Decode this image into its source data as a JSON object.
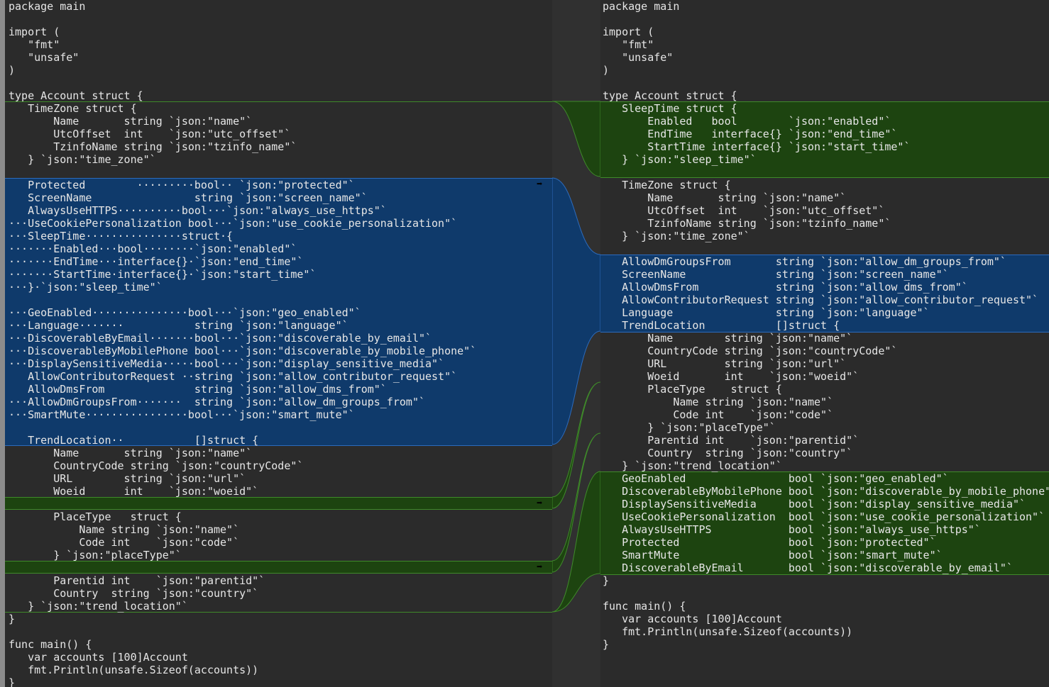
{
  "colors": {
    "background": "#2b2b2b",
    "text": "#e6e6e6",
    "changed_block": "#0f3a6b",
    "changed_border": "#2c6bbd",
    "inserted_block": "#1d4410",
    "inserted_border": "#3f8a2a",
    "gutter": "#8c8c8c"
  },
  "icons": {
    "copy_right": "arrow-right-icon",
    "copy_left": "arrow-left-icon"
  },
  "left": {
    "lines": [
      "package main",
      "",
      "import (",
      "   \"fmt\"",
      "   \"unsafe\"",
      ")",
      "",
      "type Account struct {",
      "   TimeZone struct {",
      "       Name       string `json:\"name\"`",
      "       UtcOffset  int    `json:\"utc_offset\"`",
      "       TzinfoName string `json:\"tzinfo_name\"`",
      "   } `json:\"time_zone\"`",
      "",
      "   Protected        ·········bool·· `json:\"protected\"`",
      "   ScreenName                string `json:\"screen_name\"`",
      "   AlwaysUseHTTPS··········bool···`json:\"always_use_https\"`",
      "···UseCookiePersonalization bool···`json:\"use_cookie_personalization\"`",
      "···SleepTime···············struct·{",
      "·······Enabled···bool········`json:\"enabled\"`",
      "·······EndTime···interface{}·`json:\"end_time\"`",
      "·······StartTime·interface{}·`json:\"start_time\"`",
      "···}·`json:\"sleep_time\"`",
      "",
      "···GeoEnabled···············bool···`json:\"geo_enabled\"`",
      "···Language·······           string `json:\"language\"`",
      "···DiscoverableByEmail·······bool···`json:\"discoverable_by_email\"`",
      "···DiscoverableByMobilePhone bool···`json:\"discoverable_by_mobile_phone\"`",
      "···DisplaySensitiveMedia·····bool···`json:\"display_sensitive_media\"`",
      "   AllowContributorRequest ··string `json:\"allow_contributor_request\"`",
      "   AllowDmsFrom              string `json:\"allow_dms_from\"`",
      "···AllowDmGroupsFrom·······  string `json:\"allow_dm_groups_from\"`",
      "···SmartMute················bool···`json:\"smart_mute\"`",
      "",
      "   TrendLocation··           []struct {",
      "       Name       string `json:\"name\"`",
      "       CountryCode string `json:\"countryCode\"`",
      "       URL        string `json:\"url\"`",
      "       Woeid      int    `json:\"woeid\"`",
      "",
      "       PlaceType   struct {",
      "           Name string `json:\"name\"`",
      "           Code int    `json:\"code\"`",
      "       } `json:\"placeType\"`",
      "",
      "       Parentid int    `json:\"parentid\"`",
      "       Country  string `json:\"country\"`",
      "   } `json:\"trend_location\"`",
      "}",
      "",
      "func main() {",
      "   var accounts [100]Account",
      "   fmt.Println(unsafe.Sizeof(accounts))",
      "}"
    ]
  },
  "right": {
    "lines": [
      "package main",
      "",
      "import (",
      "   \"fmt\"",
      "   \"unsafe\"",
      ")",
      "",
      "type Account struct {",
      "   SleepTime struct {",
      "       Enabled   bool        `json:\"enabled\"`",
      "       EndTime   interface{} `json:\"end_time\"`",
      "       StartTime interface{} `json:\"start_time\"`",
      "   } `json:\"sleep_time\"`",
      "",
      "   TimeZone struct {",
      "       Name       string `json:\"name\"`",
      "       UtcOffset  int    `json:\"utc_offset\"`",
      "       TzinfoName string `json:\"tzinfo_name\"`",
      "   } `json:\"time_zone\"`",
      "",
      "   AllowDmGroupsFrom       string `json:\"allow_dm_groups_from\"`",
      "   ScreenName              string `json:\"screen_name\"`",
      "   AllowDmsFrom            string `json:\"allow_dms_from\"`",
      "   AllowContributorRequest string `json:\"allow_contributor_request\"`",
      "   Language                string `json:\"language\"`",
      "   TrendLocation           []struct {",
      "       Name        string `json:\"name\"`",
      "       CountryCode string `json:\"countryCode\"`",
      "       URL         string `json:\"url\"`",
      "       Woeid       int    `json:\"woeid\"`",
      "       PlaceType    struct {",
      "           Name string `json:\"name\"`",
      "           Code int    `json:\"code\"`",
      "       } `json:\"placeType\"`",
      "       Parentid int    `json:\"parentid\"`",
      "       Country  string `json:\"country\"`",
      "   } `json:\"trend_location\"`",
      "   GeoEnabled                bool `json:\"geo_enabled\"`",
      "   DiscoverableByMobilePhone bool `json:\"discoverable_by_mobile_phone\"`",
      "   DisplaySensitiveMedia     bool `json:\"display_sensitive_media\"`",
      "   UseCookiePersonalization  bool `json:\"use_cookie_personalization\"`",
      "   AlwaysUseHTTPS            bool `json:\"always_use_https\"`",
      "   Protected                 bool `json:\"protected\"`",
      "   SmartMute                 bool `json:\"smart_mute\"`",
      "   DiscoverableByEmail       bool `json:\"discoverable_by_email\"`",
      "}",
      "",
      "func main() {",
      "   var accounts [100]Account",
      "   fmt.Println(unsafe.Sizeof(accounts))",
      "}"
    ]
  }
}
